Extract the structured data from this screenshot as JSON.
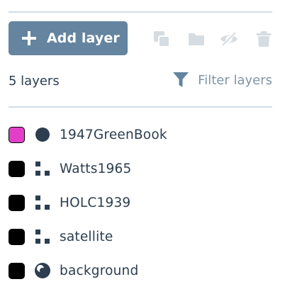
{
  "toolbar": {
    "add_label": "Add layer",
    "icons": [
      "duplicate-icon",
      "folder-icon",
      "hide-icon",
      "trash-icon"
    ],
    "disabled_icon_color": "#d6dde2"
  },
  "summary": {
    "count_label": "5 layers",
    "filter_label": "Filter layers"
  },
  "colors": {
    "button_bg": "#64849f",
    "text": "#2c3e50",
    "muted_text": "#7f95a8",
    "divider": "#d3dde3",
    "icon_dark": "#2c3e50"
  },
  "layers": [
    {
      "name": "1947GreenBook",
      "swatch": "#e23fc8",
      "type_icon": "circle-icon"
    },
    {
      "name": "Watts1965",
      "swatch": "#000000",
      "type_icon": "raster-icon"
    },
    {
      "name": "HOLC1939",
      "swatch": "#000000",
      "type_icon": "raster-icon"
    },
    {
      "name": "satellite",
      "swatch": "#000000",
      "type_icon": "raster-icon"
    },
    {
      "name": "background",
      "swatch": "#000000",
      "type_icon": "background-icon"
    }
  ]
}
